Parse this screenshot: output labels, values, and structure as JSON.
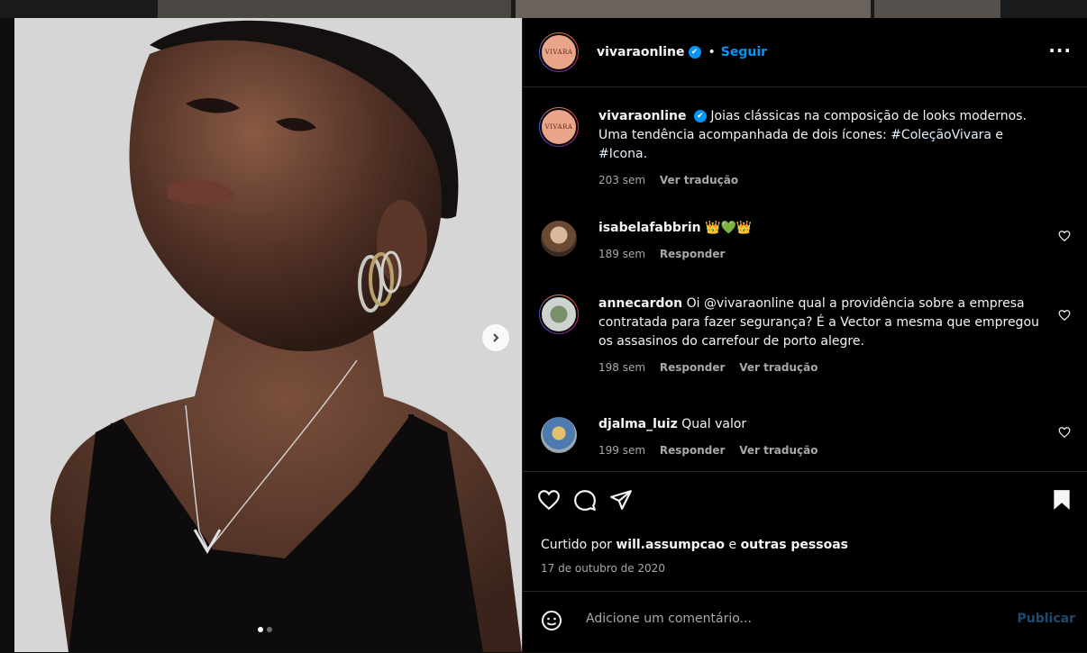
{
  "post": {
    "username": "vivaraonline",
    "avatar_text": "VIVARA",
    "follow_label": "Seguir",
    "separator": "•",
    "more_label": "···",
    "verified_mark": "✔"
  },
  "caption": {
    "username": "vivaraonline",
    "text_before": "Joias clássicas na composição de looks modernos. Uma tendência acompanhada de dois ícones: ",
    "hashtag1": "#ColeçãoVivara",
    "joiner": " e ",
    "hashtag2": "#Icona",
    "end": ".",
    "time": "203 sem",
    "translate": "Ver tradução"
  },
  "comments": [
    {
      "username": "isabelafabbrin",
      "text": "👑💚👑",
      "time": "189 sem",
      "reply": "Responder"
    },
    {
      "username": "annecardon",
      "text": "Oi @vivaraonline qual a providência sobre a empresa contratada para fazer segurança? É a Vector a mesma que empregou os assasinos do carrefour de porto alegre.",
      "time": "198 sem",
      "reply": "Responder",
      "translate": "Ver tradução"
    },
    {
      "username": "djalma_luiz",
      "text": "Qual valor",
      "time": "199 sem",
      "reply": "Responder",
      "translate": "Ver tradução"
    }
  ],
  "likes": {
    "prefix": "Curtido por ",
    "user": "will.assumpcao",
    "joiner": " e ",
    "others": "outras pessoas"
  },
  "date": "17 de outubro de 2020",
  "composer": {
    "placeholder": "Adicione um comentário...",
    "publish": "Publicar"
  },
  "carousel": {
    "current": 1,
    "total": 2
  },
  "colors": {
    "accent": "#0095f6",
    "background": "#000000",
    "muted": "#a8a8a8"
  },
  "icons": [
    "heart-icon",
    "comment-icon",
    "share-icon",
    "bookmark-icon",
    "emoji-icon",
    "chevron-right-icon"
  ]
}
